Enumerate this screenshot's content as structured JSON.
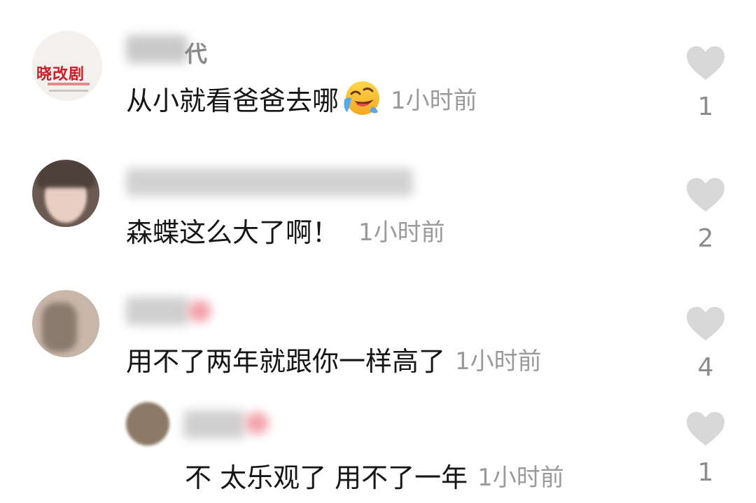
{
  "comments": [
    {
      "name_suffix": "代",
      "avatar_text": "晓改剧",
      "text": "从小就看爸爸去哪",
      "emoji": "face-with-tears-of-joy-rolling",
      "time": "1小时前",
      "likes": "1"
    },
    {
      "name_suffix": "",
      "text": "森蝶这么大了啊！",
      "time": "1小时前",
      "likes": "2"
    },
    {
      "name_suffix": "",
      "text": "用不了两年就跟你一样高了",
      "time": "1小时前",
      "likes": "4"
    }
  ],
  "reply": {
    "text": "不 太乐观了 用不了一年",
    "time": "1小时前",
    "likes": "1"
  },
  "colors": {
    "heart": "#d8d8d8",
    "content": "#161616",
    "meta": "#9a9a9a"
  }
}
